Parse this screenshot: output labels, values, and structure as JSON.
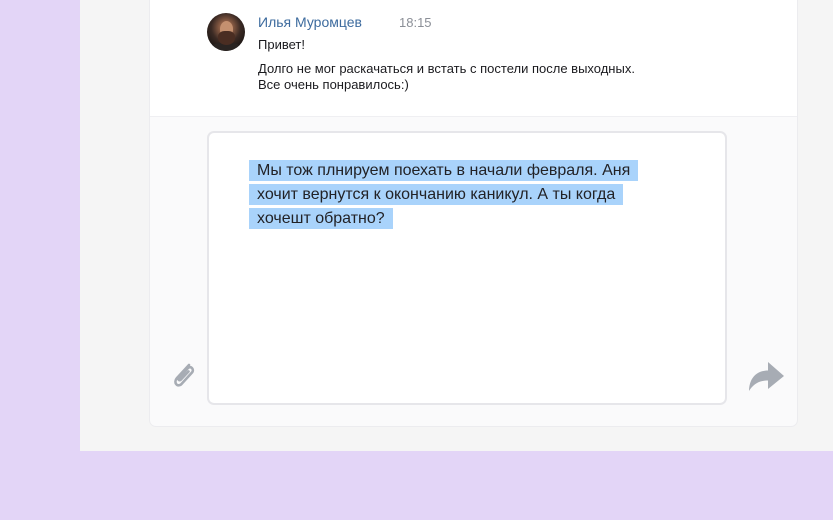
{
  "message": {
    "author": "Илья Муромцев",
    "time": "18:15",
    "lines": [
      "Привет!",
      "Долго не мог раскачаться и встать с постели после выходных.",
      "Все очень понравилось:)"
    ],
    "avatar": "avatar-photo"
  },
  "composer": {
    "text": "Мы тож плнируем поехать в начали февраля. Аня хочит вернутся к окончанию каникул. А ты когда хочешт обратно?",
    "selection_color": "#a9d3fb",
    "attach_icon": "paperclip-icon",
    "send_icon": "send-arrow-icon"
  },
  "colors": {
    "background": "#e3d5f7",
    "author": "#3d6b9e",
    "icon": "#a7acb4"
  }
}
